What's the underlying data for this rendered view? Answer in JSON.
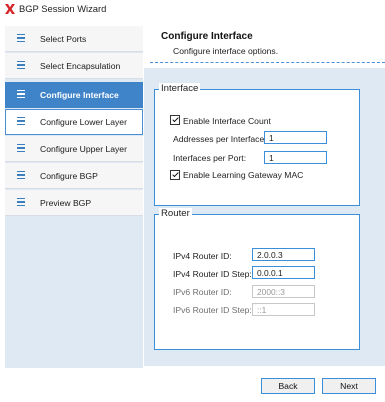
{
  "window": {
    "title": "BGP Session Wizard",
    "logo_icon": "x-logo-icon",
    "logo_color": "#d6262b"
  },
  "sidebar": {
    "items": [
      {
        "label": "Select Ports",
        "icon": "list-icon",
        "state": "normal"
      },
      {
        "label": "Select Encapsulation",
        "icon": "list-icon",
        "state": "normal"
      },
      {
        "label": "Configure Interface",
        "icon": "list-icon",
        "state": "active"
      },
      {
        "label": "Configure Lower Layer",
        "icon": "list-icon",
        "state": "hover"
      },
      {
        "label": "Configure Upper Layer",
        "icon": "list-icon",
        "state": "normal"
      },
      {
        "label": "Configure BGP",
        "icon": "list-icon",
        "state": "normal"
      },
      {
        "label": "Preview BGP",
        "icon": "list-icon",
        "state": "normal"
      }
    ]
  },
  "header": {
    "title": "Configure Interface",
    "subtitle": "Configure interface options."
  },
  "interface": {
    "legend": "Interface",
    "enable_interface_count": {
      "label": "Enable Interface Count",
      "checked": true
    },
    "addresses_per_interface": {
      "label": "Addresses per Interface:",
      "value": "1"
    },
    "interfaces_per_port": {
      "label": "Interfaces per Port:",
      "value": "1"
    },
    "enable_learning_gateway_mac": {
      "label": "Enable Learning Gateway MAC",
      "checked": true
    }
  },
  "router": {
    "legend": "Router",
    "ipv4_router_id": {
      "label": "IPv4 Router ID:",
      "value": "2.0.0.3"
    },
    "ipv4_router_id_step": {
      "label": "IPv4 Router ID Step:",
      "value": "0.0.0.1"
    },
    "ipv6_router_id": {
      "label": "IPv6 Router ID:",
      "value": "2000::3",
      "disabled": true
    },
    "ipv6_router_id_step": {
      "label": "IPv6 Router ID Step:",
      "value": "::1",
      "disabled": true
    }
  },
  "footer": {
    "back_label": "Back",
    "next_label": "Next"
  },
  "colors": {
    "accent": "#3b8fd9",
    "active_nav": "#3f83c9",
    "panel_bg": "#dfe9f4"
  }
}
